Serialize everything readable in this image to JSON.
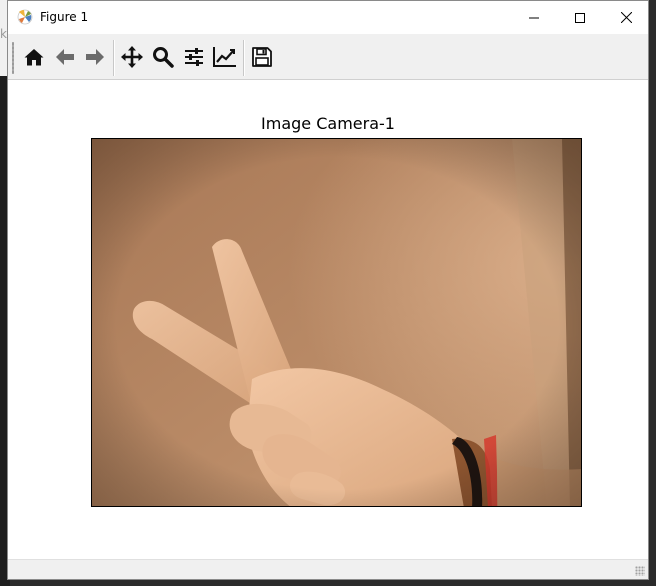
{
  "window": {
    "title": "Figure 1",
    "controls": [
      "minimize",
      "maximize",
      "close"
    ]
  },
  "background": {
    "partial_text": "k"
  },
  "toolbar": {
    "buttons": [
      {
        "name": "home",
        "icon": "home-icon"
      },
      {
        "name": "back",
        "icon": "arrow-left-icon"
      },
      {
        "name": "forward",
        "icon": "arrow-right-icon"
      },
      {
        "name": "pan",
        "icon": "move-icon"
      },
      {
        "name": "zoom",
        "icon": "zoom-icon"
      },
      {
        "name": "subplots",
        "icon": "sliders-icon"
      },
      {
        "name": "customize",
        "icon": "line-chart-icon"
      },
      {
        "name": "save",
        "icon": "save-icon"
      }
    ]
  },
  "figure": {
    "title": "Image Camera-1",
    "image_content": "webcam photo of a hand making a peace sign against a beige wall"
  },
  "colors": {
    "wall": "#b48461",
    "skin": "#e3b48e",
    "band": "#d43a2e"
  }
}
